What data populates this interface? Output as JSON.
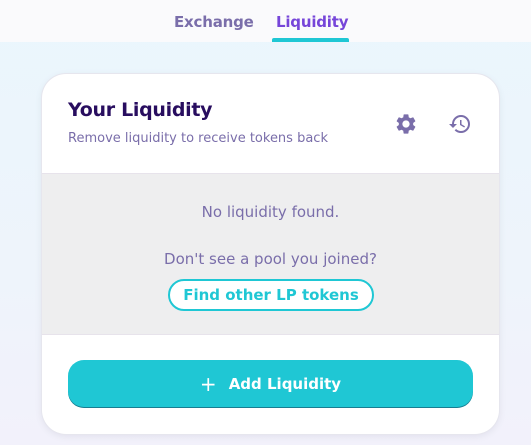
{
  "nav": {
    "tabs": [
      {
        "label": "Exchange",
        "active": false
      },
      {
        "label": "Liquidity",
        "active": true
      }
    ]
  },
  "card": {
    "title": "Your Liquidity",
    "subtitle": "Remove liquidity to receive tokens back",
    "icons": {
      "settings": "gear-icon",
      "history": "history-icon"
    },
    "empty_message": "No liquidity found.",
    "pool_prompt": "Don't see a pool you joined?",
    "find_button": "Find other LP tokens",
    "add_button": {
      "icon": "+",
      "label": "Add Liquidity"
    }
  },
  "colors": {
    "accent": "#1fc7d4",
    "primary_text": "#280d5f",
    "secondary_text": "#7a6eaa",
    "active_tab": "#7645d9"
  }
}
